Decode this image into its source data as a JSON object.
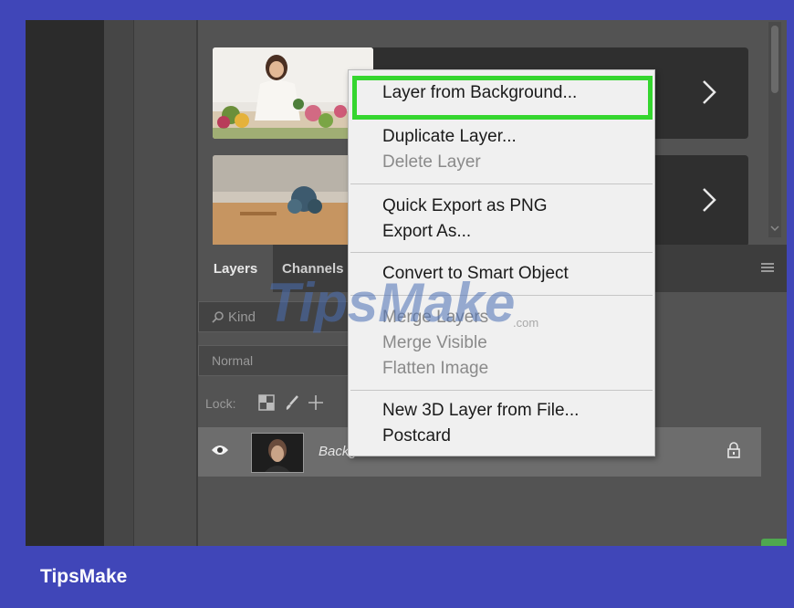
{
  "brand": {
    "name": "TipsMake"
  },
  "context_menu": {
    "items": [
      {
        "label": "Layer from Background...",
        "enabled": true,
        "highlighted": true
      },
      {
        "label": "Duplicate Layer...",
        "enabled": true
      },
      {
        "label": "Delete Layer",
        "enabled": false
      },
      {
        "label": "Quick Export as PNG",
        "enabled": true
      },
      {
        "label": "Export As...",
        "enabled": true
      },
      {
        "label": "Convert to Smart Object",
        "enabled": true
      },
      {
        "label": "Merge Layers",
        "enabled": false
      },
      {
        "label": "Merge Visible",
        "enabled": false
      },
      {
        "label": "Flatten Image",
        "enabled": false
      },
      {
        "label": "New 3D Layer from File...",
        "enabled": true
      },
      {
        "label": "Postcard",
        "enabled": true
      }
    ]
  },
  "layers_panel": {
    "tabs": [
      "Layers",
      "Channels"
    ],
    "filter_placeholder": "Kind",
    "blend_mode": "Normal",
    "lock_label": "Lock:",
    "layer": {
      "name": "Background",
      "visible": true,
      "locked": true
    }
  },
  "watermark": {
    "text": "TipsMake",
    "suffix": ".com"
  },
  "colors": {
    "highlight": "#35d62f",
    "brand_bg": "#4046b8"
  }
}
